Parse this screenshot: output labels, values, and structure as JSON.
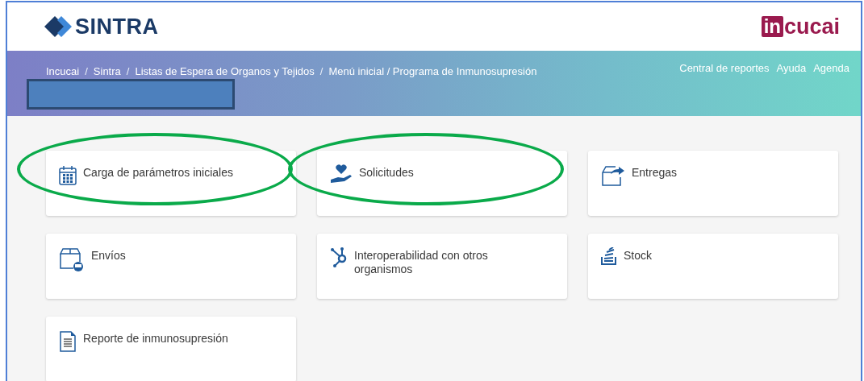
{
  "header": {
    "logo": "SINTRA",
    "partner_logo": {
      "mark": "in",
      "text": "cucai"
    }
  },
  "breadcrumb": {
    "separator": "/",
    "items": [
      "Incucai",
      "Sintra",
      "Listas de Espera de Organos y Tejidos",
      "Menú inicial / Programa de Inmunosupresión"
    ]
  },
  "nav_links": [
    "Central de reportes",
    "Ayuda",
    "Agenda"
  ],
  "cards": [
    {
      "title": "Carga de parámetros iniciales",
      "highlighted": true
    },
    {
      "title": "Solicitudes",
      "highlighted": true
    },
    {
      "title": "Entregas",
      "highlighted": false
    },
    {
      "title": "Envíos",
      "highlighted": false
    },
    {
      "title": "Interoperabilidad con otros organismos",
      "highlighted": false
    },
    {
      "title": "Stock",
      "highlighted": false
    },
    {
      "title": "Reporte de inmunosupresión",
      "highlighted": false
    }
  ]
}
